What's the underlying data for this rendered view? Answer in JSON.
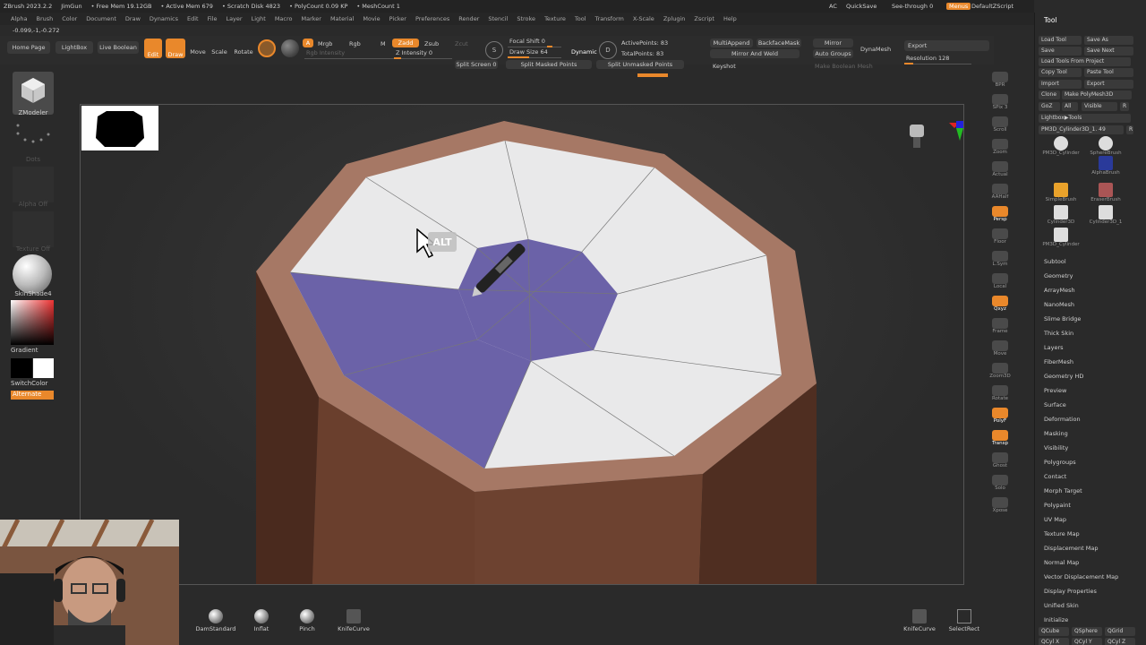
{
  "titlebar": {
    "app": "ZBrush 2023.2.2",
    "user": "JimGun",
    "free_mem": "• Free Mem 19.12GB",
    "active_mem": "• Active Mem 679",
    "scratch": "• Scratch Disk 4823",
    "polycount": "• PolyCount 0.09 KP",
    "meshcount": "• MeshCount 1",
    "ac": "AC",
    "quicksave": "QuickSave",
    "seethrough": "See-through",
    "seethrough_value": "0",
    "menus": "Menus",
    "defaultscript": "DefaultZScript"
  },
  "menubar": [
    "Alpha",
    "Brush",
    "Color",
    "Document",
    "Draw",
    "Dynamics",
    "Edit",
    "File",
    "Layer",
    "Light",
    "Macro",
    "Marker",
    "Material",
    "Movie",
    "Picker",
    "Preferences",
    "Render",
    "Stencil",
    "Stroke",
    "Texture",
    "Tool",
    "Transform",
    "X-Scale",
    "Zplugin",
    "Zscript",
    "Help"
  ],
  "coords": "-0.099,-1,-0.272",
  "toolbar": {
    "home": "Home Page",
    "lightbox": "LightBox",
    "liveboolean": "Live Boolean",
    "edit": "Edit",
    "draw": "Draw",
    "move": "Move",
    "scale": "Scale",
    "rotate": "Rotate",
    "a": "A",
    "mrgb": "Mrgb",
    "rgb": "Rgb",
    "m": "M",
    "zadd": "Zadd",
    "zsub": "Zsub",
    "zcut": "Zcut",
    "rgb_intensity": "Rgb Intensity",
    "z_intensity": "Z Intensity 0",
    "s": "S",
    "focal_shift": "Focal Shift 0",
    "draw_size": "Draw Size 64",
    "dynamic": "Dynamic",
    "d": "D",
    "active_points": "ActivePoints: 83",
    "total_points": "TotalPoints: 83",
    "split_screen": "Split Screen 0",
    "split_masked": "Split Masked Points",
    "split_unmasked": "Split Unmasked Points",
    "multiappend": "MultiAppend",
    "backfacemask": "BackfaceMask",
    "mirror_weld": "Mirror And Weld",
    "keyshot": "Keyshot",
    "mirror": "Mirror",
    "auto_groups": "Auto Groups",
    "make_boolean": "Make Boolean Mesh",
    "dynamesh": "DynaMesh",
    "export": "Export",
    "resolution": "Resolution 128"
  },
  "leftpanel": {
    "zmodeler": "ZModeler",
    "dots": "Dots",
    "alpha_off": "Alpha Off",
    "texture_off": "Texture Off",
    "material": "SkinShade4",
    "gradient": "Gradient",
    "switchcolor": "SwitchColor",
    "alternate": "Alternate"
  },
  "shelf": [
    "BPR",
    "SPix 3",
    "Scroll",
    "Zoom",
    "Actual",
    "AAHalf",
    "Persp",
    "Floor",
    "L.Sym",
    "Local",
    "Qxyz",
    "Frame",
    "Move",
    "Zoom3D",
    "Rotate",
    "PolyF",
    "Transp",
    "Ghost",
    "Solo",
    "Xpose"
  ],
  "canvas": {
    "alt_label": "ALT"
  },
  "tray": {
    "title": "Tool",
    "buttons": [
      "Load Tool",
      "Save As",
      "Save",
      "Save Next",
      "Load Tools From Project",
      "Copy Tool",
      "Paste Tool",
      "Import",
      "Export",
      "Clone",
      "Make PolyMesh3D",
      "GoZ",
      "All",
      "Visible",
      "R",
      "Lightbox▶Tools",
      "PM3D_Cylinder3D_1. 49",
      "R"
    ],
    "thumbs": [
      "PM3D_Cylinder",
      "SphereBrush",
      "AlphaBrush",
      "SimpleBrush",
      "EraserBrush",
      "Cylinder3D",
      "Cylinder3D_1",
      "PM3D_Cylinder"
    ],
    "menus": [
      "Subtool",
      "Geometry",
      "ArrayMesh",
      "NanoMesh",
      "Slime Bridge",
      "Thick Skin",
      "Layers",
      "FiberMesh",
      "Geometry HD",
      "Preview",
      "Surface",
      "Deformation",
      "Masking",
      "Visibility",
      "Polygroups",
      "Contact",
      "Morph Target",
      "Polypaint",
      "UV Map",
      "Texture Map",
      "Displacement Map",
      "Normal Map",
      "Vector Displacement Map",
      "Display Properties",
      "Unified Skin",
      "Initialize"
    ],
    "init_buttons": [
      "QCube",
      "QSphere",
      "QGrid",
      "QCyl X",
      "QCyl Y",
      "QCyl Z"
    ]
  },
  "bottom": {
    "brushes": [
      "DamStandard",
      "Inflat",
      "Pinch",
      "KnifeCurve"
    ],
    "right": [
      "KnifeCurve",
      "SelectRect"
    ]
  },
  "colors": {
    "accent": "#e9882b",
    "purple": "#6b62a8",
    "cap": "#e9e9ea",
    "rim": "#a87660",
    "side": "#6a4030"
  }
}
